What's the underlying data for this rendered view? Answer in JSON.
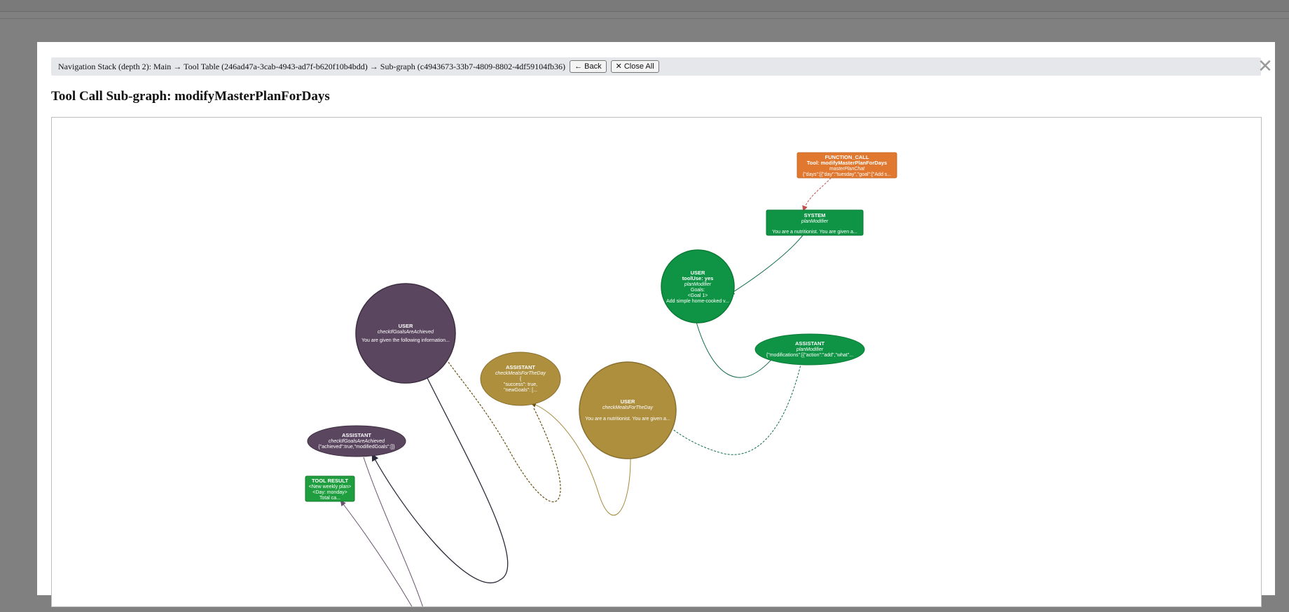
{
  "navigation": {
    "stack_text": "Navigation Stack (depth 2): Main → Tool Table (246ad47a-3cab-4943-ad7f-b620f10b4bdd) → Sub-graph (c4943673-33b7-4809-8802-4df59104fb36)",
    "back_label": "← Back",
    "close_all_label": "✕ Close All"
  },
  "close_icon": "✕",
  "page_title": "Tool Call Sub-graph: modifyMasterPlanForDays",
  "colors": {
    "function_call": "#e07830",
    "system_green": "#0e9444",
    "user_green": "#0e9444",
    "tool_result": "#1e9e3e",
    "purple": "#5b4660",
    "gold": "#ad8f3e"
  },
  "graph": {
    "nodes": [
      {
        "id": "function_call",
        "lines": [
          "FUNCTION_CALL",
          "Tool: modifyMasterPlanForDays",
          "masterPlanChat",
          "{\"days\":[{\"day\":\"tuesday\",\"goal\":[\"Add s..."
        ]
      },
      {
        "id": "system",
        "lines": [
          "SYSTEM",
          "planModifier",
          "",
          "You are a nutritionist. You are given a..."
        ]
      },
      {
        "id": "user_plan",
        "lines": [
          "USER",
          "toolUse: yes",
          "planModifier",
          "Goals:",
          "<Goal 1>",
          "Add simple home-cooked v..."
        ]
      },
      {
        "id": "assistant_plan",
        "lines": [
          "ASSISTANT",
          "planModifier",
          "{\"modifications\":[{\"action\":\"add\",\"what\"..."
        ]
      },
      {
        "id": "user_check_goals",
        "lines": [
          "USER",
          "checkIfGoalsAreAchieved",
          "",
          "You are given the following information..."
        ]
      },
      {
        "id": "assistant_meals",
        "lines": [
          "ASSISTANT",
          "checkMealsForTheDay",
          "{",
          "\"success\": true,",
          "\"newGoals\": [..."
        ]
      },
      {
        "id": "user_meals",
        "lines": [
          "USER",
          "checkMealsForTheDay",
          "",
          "You are a nutritionist. You are given a..."
        ]
      },
      {
        "id": "assistant_goals",
        "lines": [
          "ASSISTANT",
          "checkIfGoalsAreAchieved",
          "{\"achieved\":true,\"modifiedGoals\":[]}"
        ]
      },
      {
        "id": "tool_result",
        "lines": [
          "TOOL RESULT",
          "<New weekly plan>",
          "<Day: monday>",
          "Total ca..."
        ]
      }
    ]
  }
}
